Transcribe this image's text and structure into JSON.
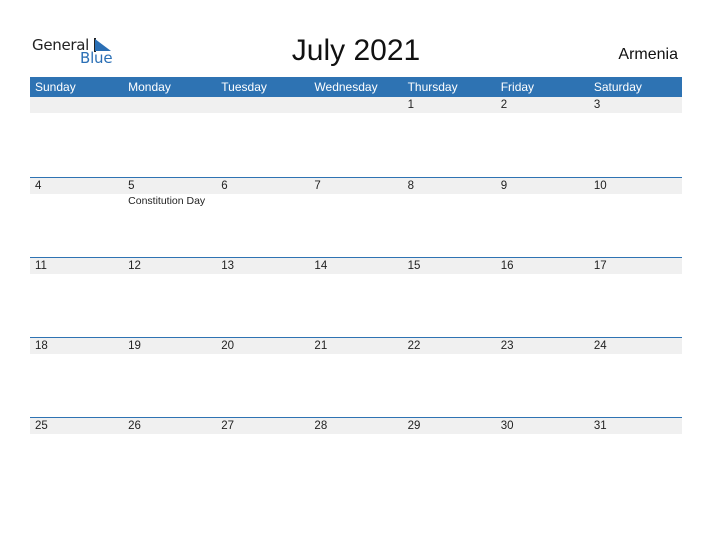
{
  "logo": {
    "word1": "General",
    "word2": "Blue"
  },
  "title": "July 2021",
  "country": "Armenia",
  "colors": {
    "accent": "#2e73b3",
    "date_strip": "#f0f0f0"
  },
  "weekdays": [
    "Sunday",
    "Monday",
    "Tuesday",
    "Wednesday",
    "Thursday",
    "Friday",
    "Saturday"
  ],
  "weeks": [
    {
      "dates": [
        "",
        "",
        "",
        "",
        "1",
        "2",
        "3"
      ],
      "events": [
        "",
        "",
        "",
        "",
        "",
        "",
        ""
      ]
    },
    {
      "dates": [
        "4",
        "5",
        "6",
        "7",
        "8",
        "9",
        "10"
      ],
      "events": [
        "",
        "Constitution Day",
        "",
        "",
        "",
        "",
        ""
      ]
    },
    {
      "dates": [
        "11",
        "12",
        "13",
        "14",
        "15",
        "16",
        "17"
      ],
      "events": [
        "",
        "",
        "",
        "",
        "",
        "",
        ""
      ]
    },
    {
      "dates": [
        "18",
        "19",
        "20",
        "21",
        "22",
        "23",
        "24"
      ],
      "events": [
        "",
        "",
        "",
        "",
        "",
        "",
        ""
      ]
    },
    {
      "dates": [
        "25",
        "26",
        "27",
        "28",
        "29",
        "30",
        "31"
      ],
      "events": [
        "",
        "",
        "",
        "",
        "",
        "",
        ""
      ]
    }
  ]
}
